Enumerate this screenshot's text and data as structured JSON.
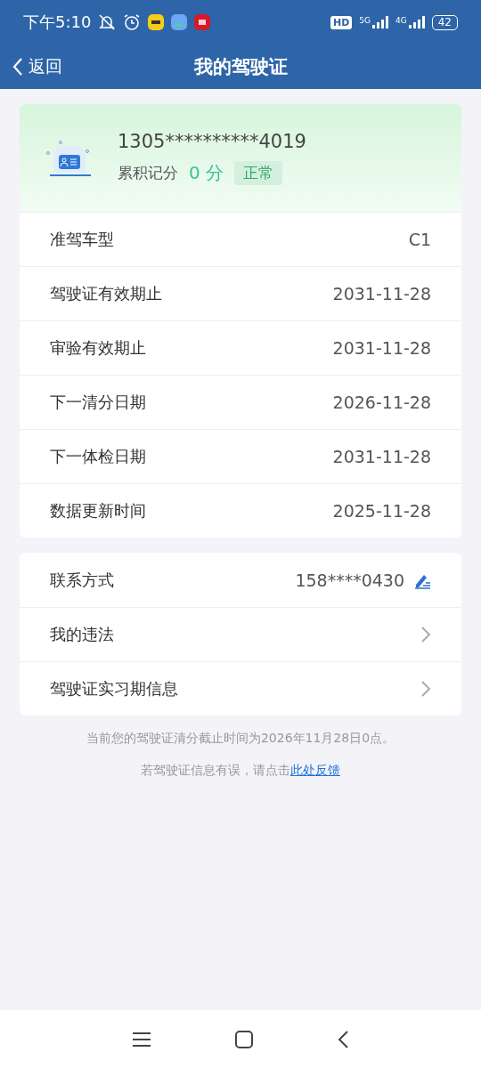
{
  "status_bar": {
    "time": "下午5:10",
    "hd": "HD",
    "net_1": "5G",
    "net_2": "4G",
    "battery": "42"
  },
  "header": {
    "back": "返回",
    "title": "我的驾驶证"
  },
  "license": {
    "number": "1305**********4019",
    "points_label": "累积记分",
    "points": "0 分",
    "status": "正常"
  },
  "details": [
    {
      "label": "准驾车型",
      "value": "C1"
    },
    {
      "label": "驾驶证有效期止",
      "value": "2031-11-28"
    },
    {
      "label": "审验有效期止",
      "value": "2031-11-28"
    },
    {
      "label": "下一清分日期",
      "value": "2026-11-28"
    },
    {
      "label": "下一体检日期",
      "value": "2031-11-28"
    },
    {
      "label": "数据更新时间",
      "value": "2025-11-28"
    }
  ],
  "actions": [
    {
      "kind": "edit",
      "label": "联系方式",
      "value": "158****0430"
    },
    {
      "kind": "link",
      "label": "我的违法"
    },
    {
      "kind": "link",
      "label": "驾驶证实习期信息"
    }
  ],
  "notice": "当前您的驾驶证清分截止时间为2026年11月28日0点。",
  "feedback": {
    "text": "若驾驶证信息有误，请点击",
    "link": "此处反馈"
  }
}
